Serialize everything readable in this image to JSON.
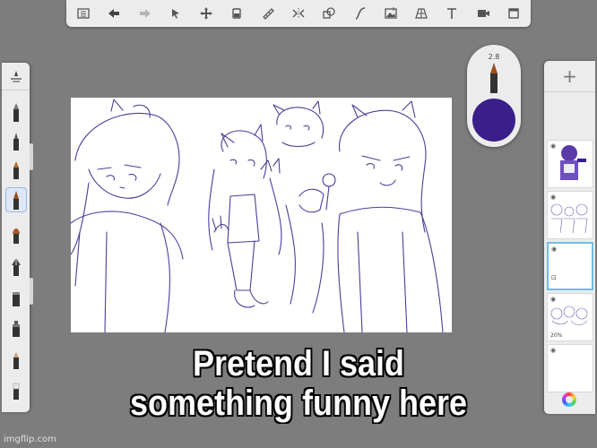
{
  "toolbar": {
    "tools": [
      {
        "name": "list-icon",
        "glyph": "≡"
      },
      {
        "name": "undo-icon",
        "glyph": "⬅"
      },
      {
        "name": "redo-icon",
        "glyph": "➡"
      },
      {
        "name": "select-icon",
        "glyph": "⬚"
      },
      {
        "name": "transform-icon",
        "glyph": "✢"
      },
      {
        "name": "fill-icon",
        "glyph": "▮"
      },
      {
        "name": "ruler-icon",
        "glyph": "⧄"
      },
      {
        "name": "symmetry-icon",
        "glyph": "⟗"
      },
      {
        "name": "shapes-icon",
        "glyph": "◰"
      },
      {
        "name": "curve-icon",
        "glyph": "∫"
      },
      {
        "name": "image-icon",
        "glyph": "▣"
      },
      {
        "name": "perspective-icon",
        "glyph": "⊞"
      },
      {
        "name": "text-icon",
        "glyph": "T"
      },
      {
        "name": "video-icon",
        "glyph": "▭"
      },
      {
        "name": "fullscreen-icon",
        "glyph": "□"
      }
    ]
  },
  "brush_puck": {
    "size": "2.8",
    "color": "#3a1f8a"
  },
  "layers": {
    "add_label": "+",
    "items": [
      {
        "name": "layer-colored-character",
        "opacity": "",
        "selected": false
      },
      {
        "name": "layer-lineart-group",
        "opacity": "",
        "selected": false
      },
      {
        "name": "layer-empty",
        "opacity": "",
        "selected": true
      },
      {
        "name": "layer-sketch",
        "opacity": "20%",
        "selected": false
      },
      {
        "name": "layer-blank",
        "opacity": "",
        "selected": false
      }
    ]
  },
  "caption": {
    "line1": "Pretend I said",
    "line2": "something funny here"
  },
  "watermark": "imgflip.com",
  "colors": {
    "accent": "#6ec0e8",
    "lineart": "#4a3f9a",
    "brush_color": "#3a1f8a"
  }
}
